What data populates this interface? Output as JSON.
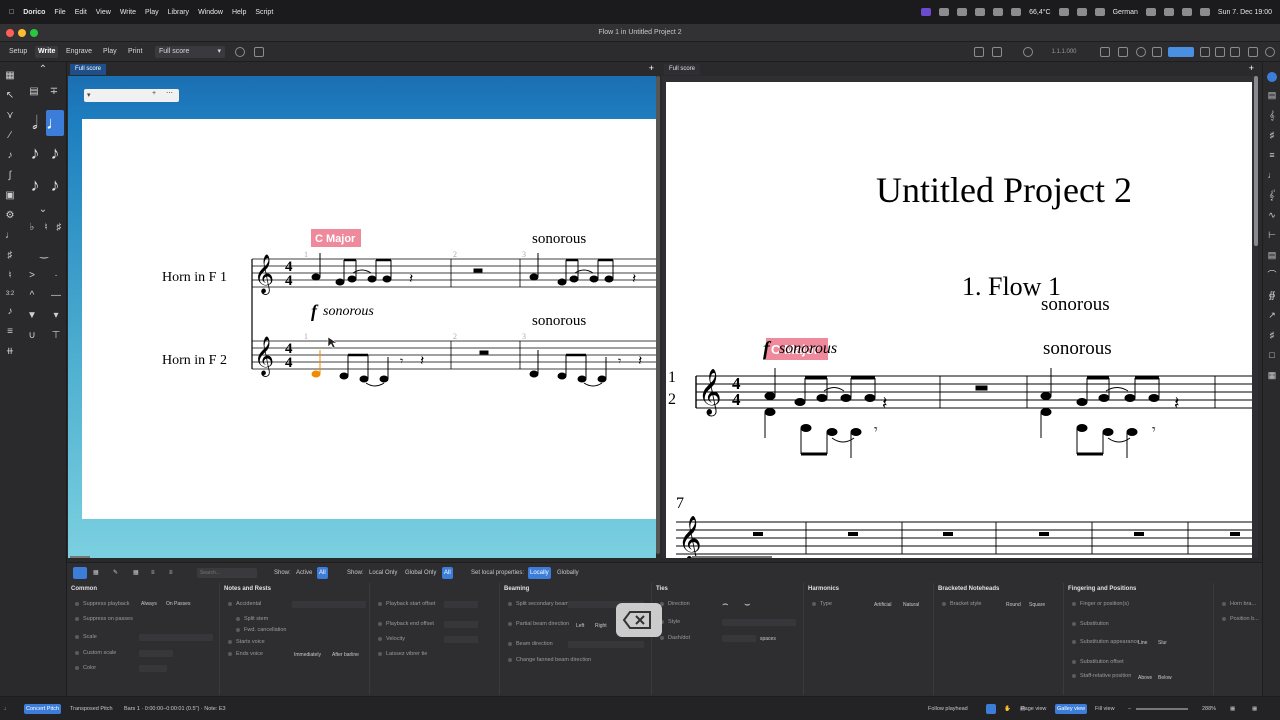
{
  "menubar": {
    "app": "Dorico",
    "items": [
      "File",
      "Edit",
      "View",
      "Write",
      "Play",
      "Library",
      "Window",
      "Help",
      "Script"
    ],
    "temperature": "66,4°C",
    "language": "German",
    "datetime": "Sun 7. Dec 19:00"
  },
  "window": {
    "title": "Flow 1 in Untitled Project 2"
  },
  "toolbar": {
    "modes": [
      "Setup",
      "Write",
      "Engrave",
      "Play",
      "Print"
    ],
    "active_mode": "Write",
    "layout_select": "Full score",
    "counter": "1.1.1.000"
  },
  "left_pane": {
    "tab": "Full score",
    "overlay_text": "cist",
    "staves": [
      {
        "name": "Horn in F 1",
        "dynamic_letter": "f",
        "dynamic_text": "sonorous"
      },
      {
        "name": "Horn in F 2"
      }
    ],
    "key_signal": "C Major",
    "bar_numbers": [
      "1",
      "2",
      "3"
    ],
    "expression_bar3": "sonorous"
  },
  "right_pane": {
    "tab": "Full score",
    "project_title": "Untitled Project 2",
    "flow_title": "1. Flow 1",
    "key_signal": "C Major",
    "dynamic_letter": "f",
    "dynamic_text": "sonorous",
    "expressions": [
      "sonorous",
      "sonorous"
    ],
    "staff_labels": [
      "1",
      "2"
    ],
    "system2_bar": "7"
  },
  "properties": {
    "show_label_1": "Show:",
    "show_opts_1": [
      "Active",
      "All"
    ],
    "show_label_2": "Show:",
    "show_opts_2": [
      "Local Only",
      "Global Only",
      "All"
    ],
    "set_local_label": "Set local properties:",
    "set_local_opts": [
      "Locally",
      "Globally"
    ],
    "search_placeholder": "Search...",
    "groups": [
      {
        "title": "Common",
        "rows": [
          "Suppress playback",
          "Suppress on passes",
          "Scale",
          "Custom scale",
          "Color"
        ],
        "buttons": [
          "Always",
          "On Passes"
        ]
      },
      {
        "title": "Notes and Rests",
        "rows": [
          "Accidental",
          "Split stem",
          "Fwd. cancellation",
          "Starts voice",
          "Ends voice"
        ],
        "buttons": [
          "Immediately",
          "After barline"
        ]
      },
      {
        "title": "",
        "rows": [
          "Playback start offset",
          "Playback end offset",
          "Velocity",
          "Laissez vibrer tie"
        ]
      },
      {
        "title": "Beaming",
        "rows": [
          "Split secondary beam",
          "Partial beam direction",
          "Beam direction",
          "Change fanned beam direction"
        ],
        "buttons": [
          "Left",
          "Right"
        ]
      },
      {
        "title": "Ties",
        "rows": [
          "Direction",
          "Style",
          "Dash/dot"
        ],
        "buttons": [
          "spaces"
        ]
      },
      {
        "title": "Harmonics",
        "rows": [
          "Type"
        ],
        "buttons": [
          "Artificial",
          "Natural"
        ]
      },
      {
        "title": "Bracketed Noteheads",
        "rows": [
          "Bracket style"
        ],
        "buttons": [
          "Round",
          "Square"
        ]
      },
      {
        "title": "Fingering and Positions",
        "rows": [
          "Finger or position(s)",
          "Substitution",
          "Substitution appearance",
          "Substitution offset",
          "Staff-relative position"
        ],
        "buttons": [
          "Line",
          "Slur",
          "Above",
          "Below"
        ]
      },
      {
        "title": "",
        "rows": [
          "Horn bra...",
          "Position b..."
        ]
      }
    ]
  },
  "status": {
    "concert_pitch": "Concert Pitch",
    "transposed_pitch": "Transposed Pitch",
    "info": "Bars 1 · 0:00:00–0:00:01 (0.5\") · Note: E3",
    "follow_playhead": "Follow playhead",
    "page_view": "Page view",
    "galley_view": "Galley view",
    "fill_view": "Fill view",
    "zoom": "288%"
  }
}
